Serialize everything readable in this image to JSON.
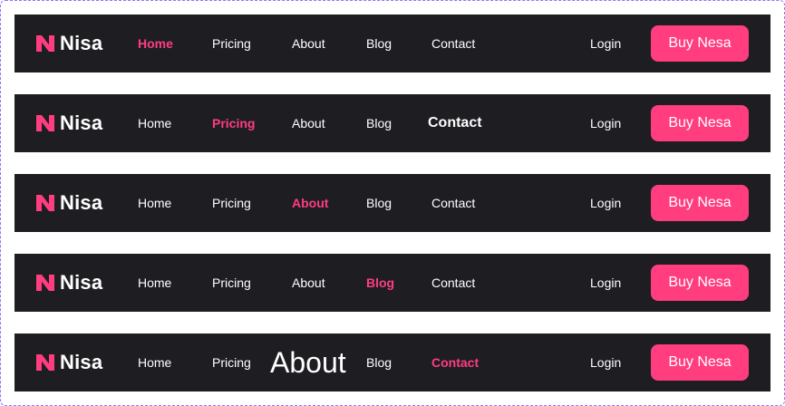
{
  "brand": {
    "name": "Nisa",
    "accent_color": "#ff3d7f",
    "bar_color": "#1e1d22",
    "logo_icon": "n-logo-icon"
  },
  "navbars": [
    {
      "links": [
        "Home",
        "Pricing",
        "About",
        "Blog",
        "Contact"
      ],
      "active": "Home",
      "login_label": "Login",
      "cta_label": "Buy Nesa"
    },
    {
      "links": [
        "Home",
        "Pricing",
        "About",
        "Blog",
        "Contact"
      ],
      "active": "Pricing",
      "login_label": "Login",
      "cta_label": "Buy Nesa"
    },
    {
      "links": [
        "Home",
        "Pricing",
        "About",
        "Blog",
        "Contact"
      ],
      "active": "About",
      "login_label": "Login",
      "cta_label": "Buy Nesa"
    },
    {
      "links": [
        "Home",
        "Pricing",
        "About",
        "Blog",
        "Contact"
      ],
      "active": "Blog",
      "login_label": "Login",
      "cta_label": "Buy Nesa"
    },
    {
      "links": [
        "Home",
        "Pricing",
        "About",
        "Blog",
        "Contact"
      ],
      "active": "Contact",
      "login_label": "Login",
      "cta_label": "Buy Nesa"
    }
  ]
}
